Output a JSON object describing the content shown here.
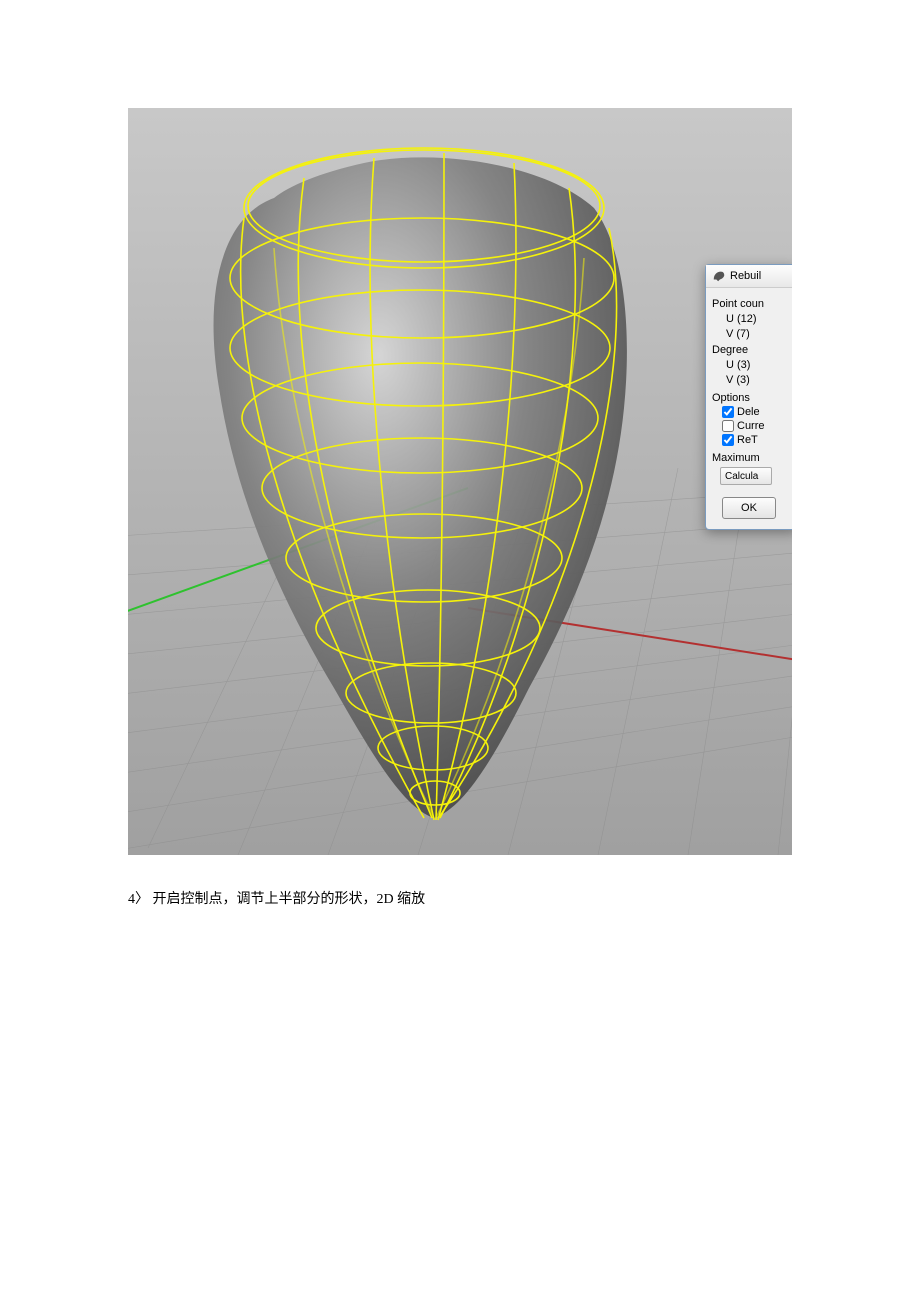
{
  "dialog": {
    "title": "Rebuil",
    "point_count_label": "Point coun",
    "u_point": "U (12)",
    "v_point": "V (7)",
    "degree_label": "Degree",
    "u_degree": "U (3)",
    "v_degree": "V (3)",
    "options_label": "Options",
    "opt_delete": {
      "label": "Dele",
      "checked": true
    },
    "opt_current": {
      "label": "Curre",
      "checked": false
    },
    "opt_retrim": {
      "label": "ReT",
      "checked": true
    },
    "maximum_label": "Maximum",
    "calc_button": "Calcula",
    "ok_button": "OK"
  },
  "caption": {
    "prefix": "4〉 开启控制点，调节上半部分的形状，2D 缩放"
  },
  "icons": {
    "rhino": "rhino-icon"
  }
}
